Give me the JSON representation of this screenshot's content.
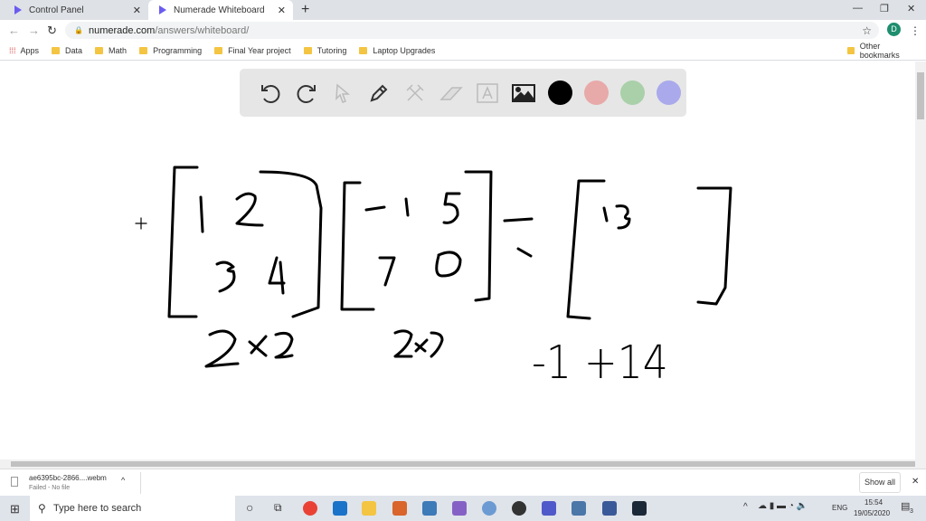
{
  "tabs": [
    {
      "label": "Control Panel",
      "active": false
    },
    {
      "label": "Numerade Whiteboard",
      "active": true
    }
  ],
  "address": {
    "url_host": "numerade.com",
    "url_path": "/answers/whiteboard/",
    "profile_initial": "D"
  },
  "bookmarks": {
    "items": [
      "Apps",
      "Data",
      "Math",
      "Programming",
      "Final Year project",
      "Tutoring",
      "Laptop Upgrades"
    ],
    "other": "Other bookmarks"
  },
  "toolbar": {
    "tools": [
      "undo-icon",
      "redo-icon",
      "select-icon",
      "pen-icon",
      "tools-icon",
      "eraser-icon",
      "text-icon",
      "image-icon"
    ],
    "colors": [
      "#000000",
      "#e8a9a9",
      "#a9d0a9",
      "#a9a9ec"
    ]
  },
  "whiteboard": {
    "labels": [
      "2x2",
      "2x2",
      "-1 +14"
    ]
  },
  "download": {
    "filename": "ae6395bc-2866....webm",
    "status": "Failed - No file",
    "show_all": "Show all"
  },
  "taskbar": {
    "search_placeholder": "Type here to search",
    "lang": "ENG",
    "time": "15:54",
    "date": "19/05/2020",
    "notifications": "3"
  }
}
